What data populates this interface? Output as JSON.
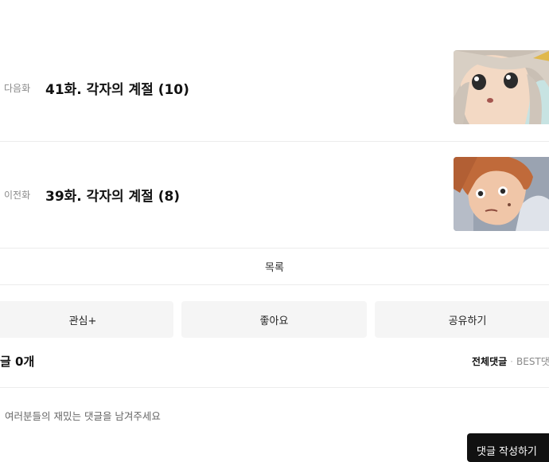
{
  "next_episode": {
    "kind_label": "다음화",
    "title": "41화. 각자의 계절 (10)"
  },
  "prev_episode": {
    "kind_label": "이전화",
    "title": "39화. 각자의 계절 (8)"
  },
  "list_button": "목록",
  "actions": {
    "interest": "관심+",
    "like": "좋아요",
    "share": "공유하기"
  },
  "comments": {
    "count_label": "글 0개",
    "tab_all": "전체댓글",
    "separator": "·",
    "tab_best": "BEST댓",
    "placeholder": "여러분들의 재밌는 댓글을 남겨주세요",
    "write_button": "댓글 작성하기"
  }
}
